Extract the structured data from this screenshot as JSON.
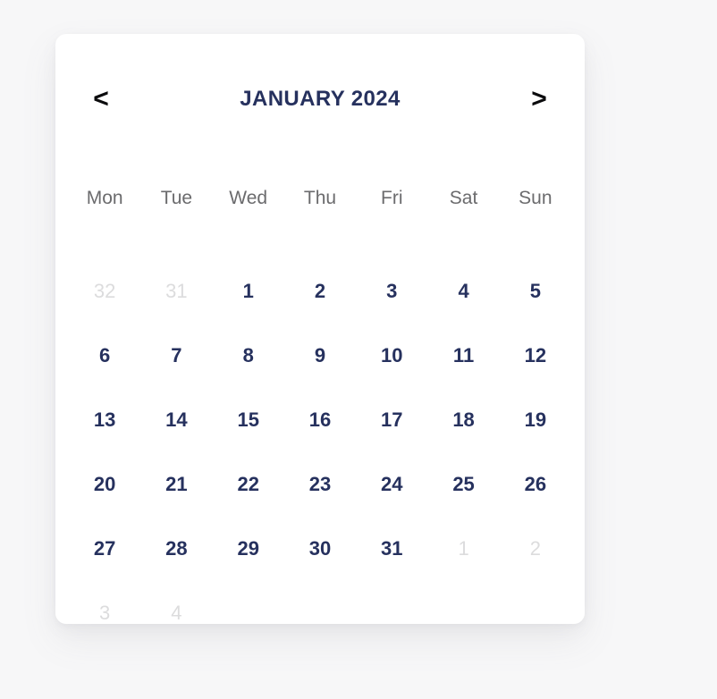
{
  "calendar": {
    "title": "JANUARY 2024",
    "prev_label": "<",
    "next_label": ">",
    "weekdays": [
      "Mon",
      "Tue",
      "Wed",
      "Thu",
      "Fri",
      "Sat",
      "Sun"
    ],
    "colors": {
      "accent": "#26315e",
      "muted": "#dcdcdd",
      "weekday": "#6b6b6d",
      "arrow": "#0b0b0d",
      "card_background": "#ffffff",
      "page_background": "#f7f7f8"
    },
    "weeks": [
      [
        {
          "label": "32",
          "state": "muted"
        },
        {
          "label": "31",
          "state": "muted"
        },
        {
          "label": "1",
          "state": "current"
        },
        {
          "label": "2",
          "state": "current"
        },
        {
          "label": "3",
          "state": "current"
        },
        {
          "label": "4",
          "state": "current"
        },
        {
          "label": "5",
          "state": "current"
        }
      ],
      [
        {
          "label": "6",
          "state": "current"
        },
        {
          "label": "7",
          "state": "current"
        },
        {
          "label": "8",
          "state": "current"
        },
        {
          "label": "9",
          "state": "current"
        },
        {
          "label": "10",
          "state": "current"
        },
        {
          "label": "11",
          "state": "current"
        },
        {
          "label": "12",
          "state": "current"
        }
      ],
      [
        {
          "label": "13",
          "state": "current"
        },
        {
          "label": "14",
          "state": "current"
        },
        {
          "label": "15",
          "state": "current"
        },
        {
          "label": "16",
          "state": "current"
        },
        {
          "label": "17",
          "state": "current"
        },
        {
          "label": "18",
          "state": "current"
        },
        {
          "label": "19",
          "state": "current"
        }
      ],
      [
        {
          "label": "20",
          "state": "current"
        },
        {
          "label": "21",
          "state": "current"
        },
        {
          "label": "22",
          "state": "current"
        },
        {
          "label": "23",
          "state": "current"
        },
        {
          "label": "24",
          "state": "current"
        },
        {
          "label": "25",
          "state": "current"
        },
        {
          "label": "26",
          "state": "current"
        }
      ],
      [
        {
          "label": "27",
          "state": "current"
        },
        {
          "label": "28",
          "state": "current"
        },
        {
          "label": "29",
          "state": "current"
        },
        {
          "label": "30",
          "state": "current"
        },
        {
          "label": "31",
          "state": "current"
        },
        {
          "label": "1",
          "state": "muted"
        },
        {
          "label": "2",
          "state": "muted"
        }
      ],
      [
        {
          "label": "3",
          "state": "muted"
        },
        {
          "label": "4",
          "state": "muted"
        },
        {
          "label": "",
          "state": "empty"
        },
        {
          "label": "",
          "state": "empty"
        },
        {
          "label": "",
          "state": "empty"
        },
        {
          "label": "",
          "state": "empty"
        },
        {
          "label": "",
          "state": "empty"
        }
      ]
    ]
  }
}
